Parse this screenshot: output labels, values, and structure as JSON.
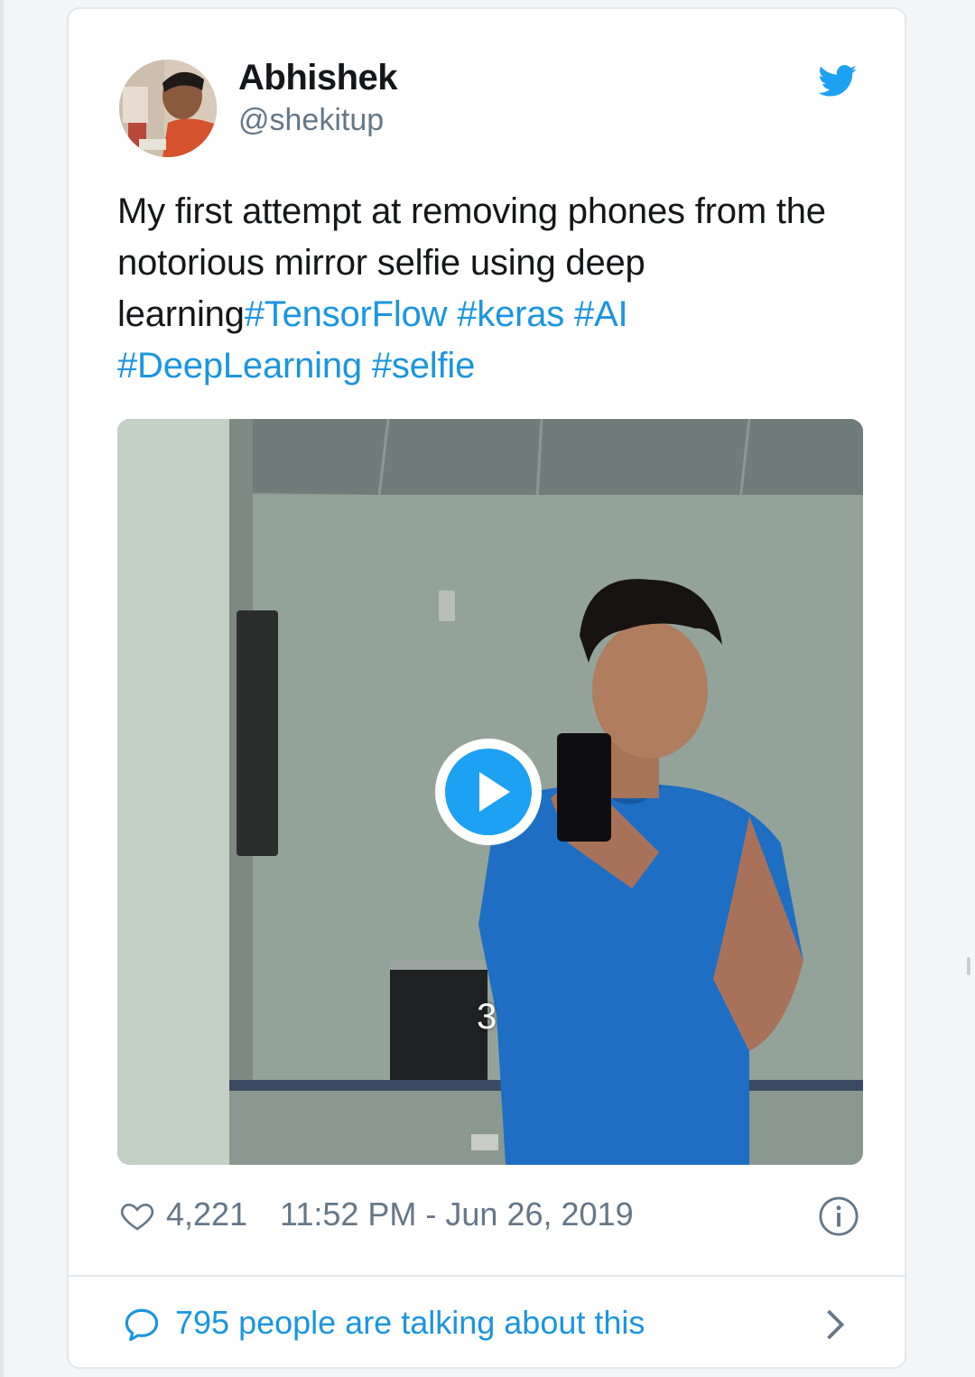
{
  "author": {
    "name": "Abhishek",
    "handle": "@shekitup"
  },
  "tweet": {
    "text_plain": "My first attempt at removing phones from the notorious mirror selfie using deep learning",
    "hashtags": [
      "#TensorFlow",
      "#keras",
      "#AI",
      "#DeepLearning",
      "#selfie"
    ]
  },
  "media": {
    "type": "video",
    "counter": "3"
  },
  "meta": {
    "like_count": "4,221",
    "timestamp": "11:52 PM - Jun 26, 2019"
  },
  "footer": {
    "talking_text": "795 people are talking about this"
  },
  "colors": {
    "accent": "#1da1f2",
    "link": "#1b95e0",
    "text": "#14171a",
    "muted": "#657786",
    "border": "#e1e8ed"
  },
  "icons": [
    "twitter-bird-icon",
    "play-icon",
    "heart-icon",
    "info-icon",
    "speech-bubble-icon",
    "chevron-right-icon"
  ]
}
